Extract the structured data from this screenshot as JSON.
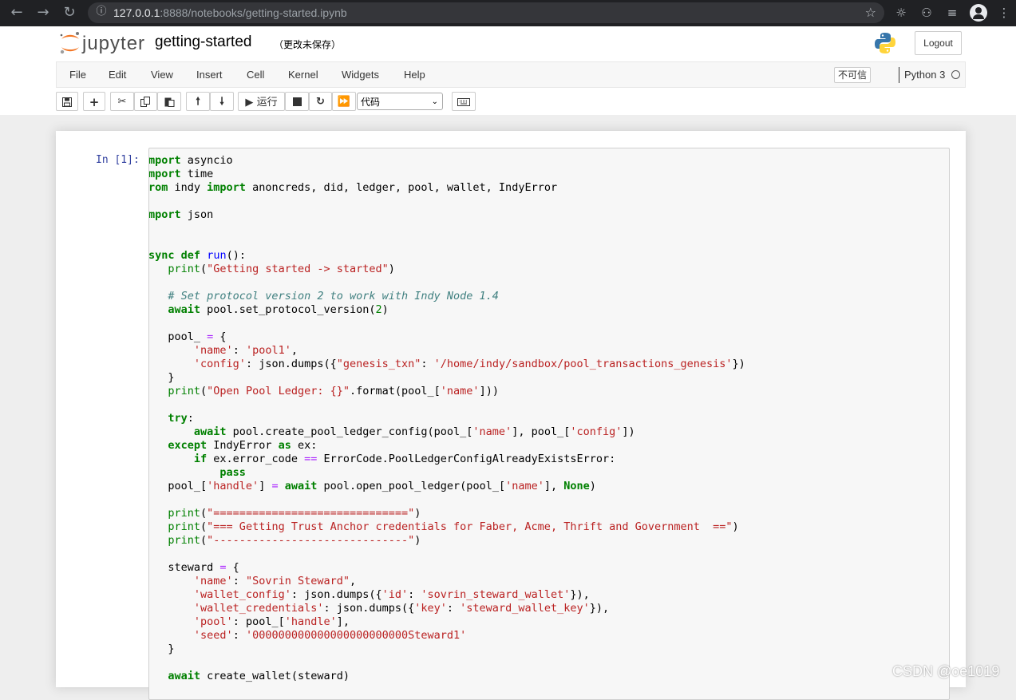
{
  "browser": {
    "url_host": "127.0.0.1",
    "url_rest": ":8888/notebooks/getting-started.ipynb"
  },
  "header": {
    "logo_text": "jupyter",
    "notebook_name": "getting-started",
    "save_status": "（更改未保存）",
    "logout_label": "Logout"
  },
  "menu": {
    "items": [
      "File",
      "Edit",
      "View",
      "Insert",
      "Cell",
      "Kernel",
      "Widgets",
      "Help"
    ],
    "trust_label": "不可信",
    "kernel_name": "Python 3"
  },
  "toolbar": {
    "run_label": "运行",
    "cell_type": "代码"
  },
  "cell": {
    "prompt": "In [1]:"
  },
  "code_lines": [
    "mport asyncio",
    "mport time",
    "rom indy import anoncreds, did, ledger, pool, wallet, IndyError",
    "",
    "mport json",
    "",
    "",
    "sync def run():",
    "   print(\"Getting started -> started\")",
    "",
    "   # Set protocol version 2 to work with Indy Node 1.4",
    "   await pool.set_protocol_version(2)",
    "",
    "   pool_ = {",
    "       'name': 'pool1',",
    "       'config': json.dumps({\"genesis_txn\": '/home/indy/sandbox/pool_transactions_genesis'})",
    "   }",
    "   print(\"Open Pool Ledger: {}\".format(pool_['name']))",
    "",
    "   try:",
    "       await pool.create_pool_ledger_config(pool_['name'], pool_['config'])",
    "   except IndyError as ex:",
    "       if ex.error_code == ErrorCode.PoolLedgerConfigAlreadyExistsError:",
    "           pass",
    "   pool_['handle'] = await pool.open_pool_ledger(pool_['name'], None)",
    "",
    "   print(\"==============================\")",
    "   print(\"=== Getting Trust Anchor credentials for Faber, Acme, Thrift and Government  ==\")",
    "   print(\"------------------------------\")",
    "",
    "   steward = {",
    "       'name': \"Sovrin Steward\",",
    "       'wallet_config': json.dumps({'id': 'sovrin_steward_wallet'}),",
    "       'wallet_credentials': json.dumps({'key': 'steward_wallet_key'}),",
    "       'pool': pool_['handle'],",
    "       'seed': '000000000000000000000000Steward1'",
    "   }",
    "",
    "   await create_wallet(steward)"
  ],
  "watermark": "CSDN @oe1019",
  "colors": {
    "keyword": "#008000",
    "string": "#ba2121",
    "comment": "#408080",
    "operator": "#aa22ff",
    "function": "#0000ff",
    "prompt": "#303f9f"
  }
}
